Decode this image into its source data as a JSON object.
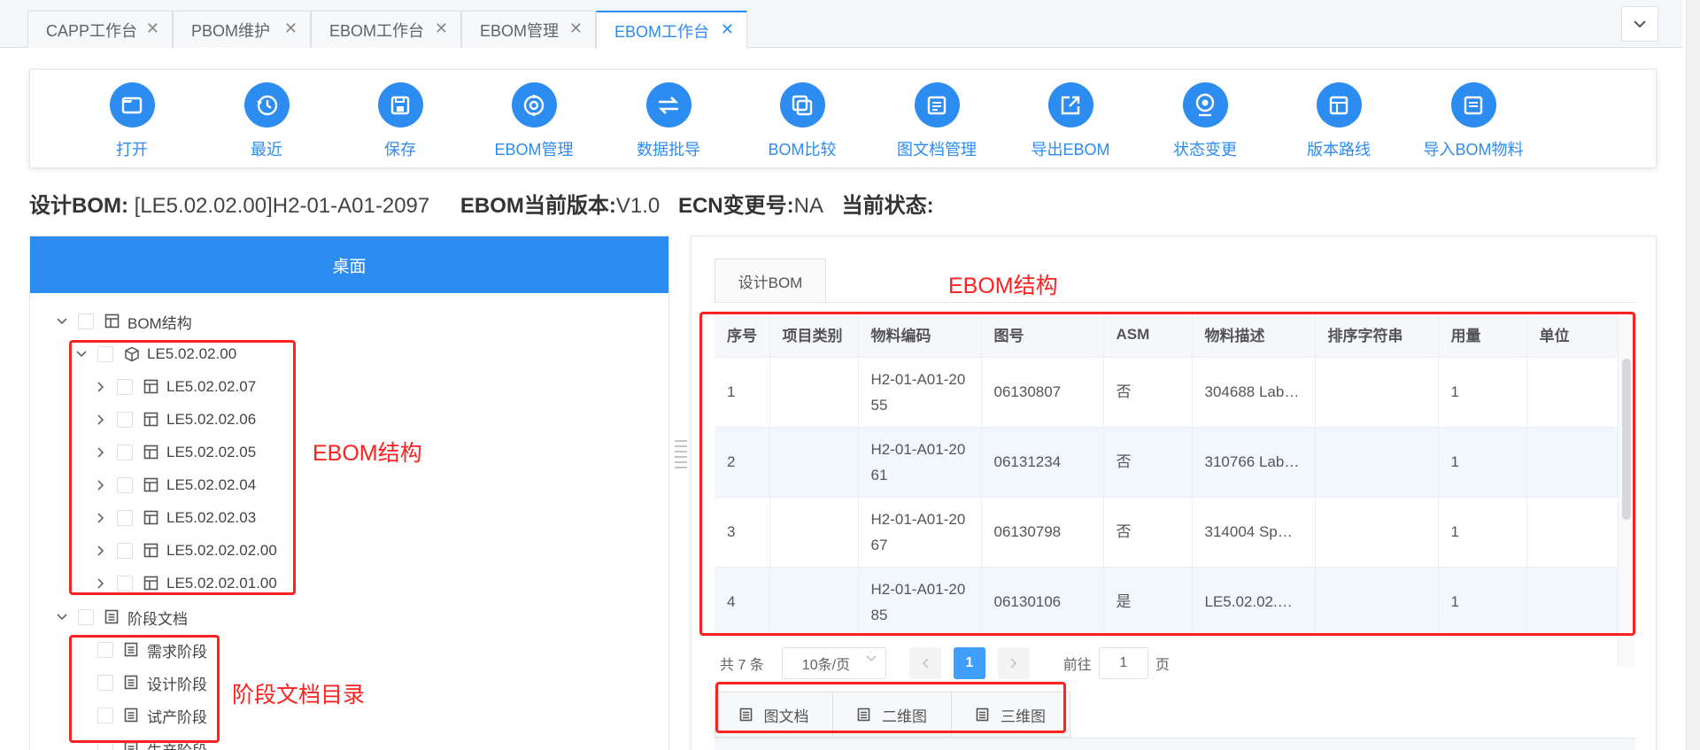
{
  "tabs": [
    {
      "label": "CAPP工作台",
      "active": false
    },
    {
      "label": "PBOM维护",
      "active": false
    },
    {
      "label": "EBOM工作台",
      "active": false
    },
    {
      "label": "EBOM管理",
      "active": false
    },
    {
      "label": "EBOM工作台",
      "active": true
    }
  ],
  "toolbar": [
    {
      "label": "打开",
      "icon": "folder-icon"
    },
    {
      "label": "最近",
      "icon": "history-icon"
    },
    {
      "label": "保存",
      "icon": "save-icon"
    },
    {
      "label": "EBOM管理",
      "icon": "manage-icon"
    },
    {
      "label": "数据批导",
      "icon": "import-swap-icon"
    },
    {
      "label": "BOM比较",
      "icon": "compare-icon"
    },
    {
      "label": "图文档管理",
      "icon": "document-icon"
    },
    {
      "label": "导出EBOM",
      "icon": "export-icon"
    },
    {
      "label": "状态变更",
      "icon": "status-icon"
    },
    {
      "label": "版本路线",
      "icon": "version-icon"
    },
    {
      "label": "导入BOM物料",
      "icon": "import-material-icon"
    }
  ],
  "info": {
    "design_bom_label": "设计BOM:",
    "design_bom_value": "[LE5.02.02.00]H2-01-A01-2097",
    "ebom_version_label": "EBOM当前版本:",
    "ebom_version_value": "V1.0",
    "ecn_label": "ECN变更号:",
    "ecn_value": "NA",
    "status_label": "当前状态:"
  },
  "left_panel": {
    "title": "桌面",
    "tree": {
      "root_bom": "BOM结构",
      "bom_node": "LE5.02.02.00",
      "bom_children": [
        "LE5.02.02.07",
        "LE5.02.02.06",
        "LE5.02.02.05",
        "LE5.02.02.04",
        "LE5.02.02.03",
        "LE5.02.02.02.00",
        "LE5.02.02.01.00"
      ],
      "root_docs": "阶段文档",
      "doc_children": [
        "需求阶段",
        "设计阶段",
        "试产阶段",
        "生产阶段"
      ]
    }
  },
  "right_panel": {
    "tab_label": "设计BOM",
    "table": {
      "columns": [
        "序号",
        "项目类别",
        "物料编码",
        "图号",
        "ASM",
        "物料描述",
        "排序字符串",
        "用量",
        "单位"
      ],
      "rows": [
        {
          "seq": "1",
          "cat": "",
          "code1": "H2-01-A01-20",
          "code2": "55",
          "drawing": "06130807",
          "asm": "否",
          "desc": "304688 Lab…",
          "sort": "",
          "qty": "1",
          "unit": ""
        },
        {
          "seq": "2",
          "cat": "",
          "code1": "H2-01-A01-20",
          "code2": "61",
          "drawing": "06131234",
          "asm": "否",
          "desc": "310766 Lab…",
          "sort": "",
          "qty": "1",
          "unit": ""
        },
        {
          "seq": "3",
          "cat": "",
          "code1": "H2-01-A01-20",
          "code2": "67",
          "drawing": "06130798",
          "asm": "否",
          "desc": "314004 Sp…",
          "sort": "",
          "qty": "1",
          "unit": ""
        },
        {
          "seq": "4",
          "cat": "",
          "code1": "H2-01-A01-20",
          "code2": "85",
          "drawing": "06130106",
          "asm": "是",
          "desc": "LE5.02.02.…",
          "sort": "",
          "qty": "1",
          "unit": ""
        }
      ]
    },
    "pagination": {
      "total": "共 7 条",
      "page_size": "10条/页",
      "current": "1",
      "goto_label": "前往",
      "goto_value": "1",
      "page_suffix": "页"
    },
    "bottom_tabs": [
      "图文档",
      "二维图",
      "三维图"
    ]
  },
  "annotations": {
    "ebom_right": "EBOM结构",
    "ebom_left": "EBOM结构",
    "stage_docs": "阶段文档目录",
    "color": "#ff2020"
  },
  "colors": {
    "primary": "#2d8cf0",
    "header_bg": "#2d8cf0",
    "annotation": "#ff2020"
  }
}
